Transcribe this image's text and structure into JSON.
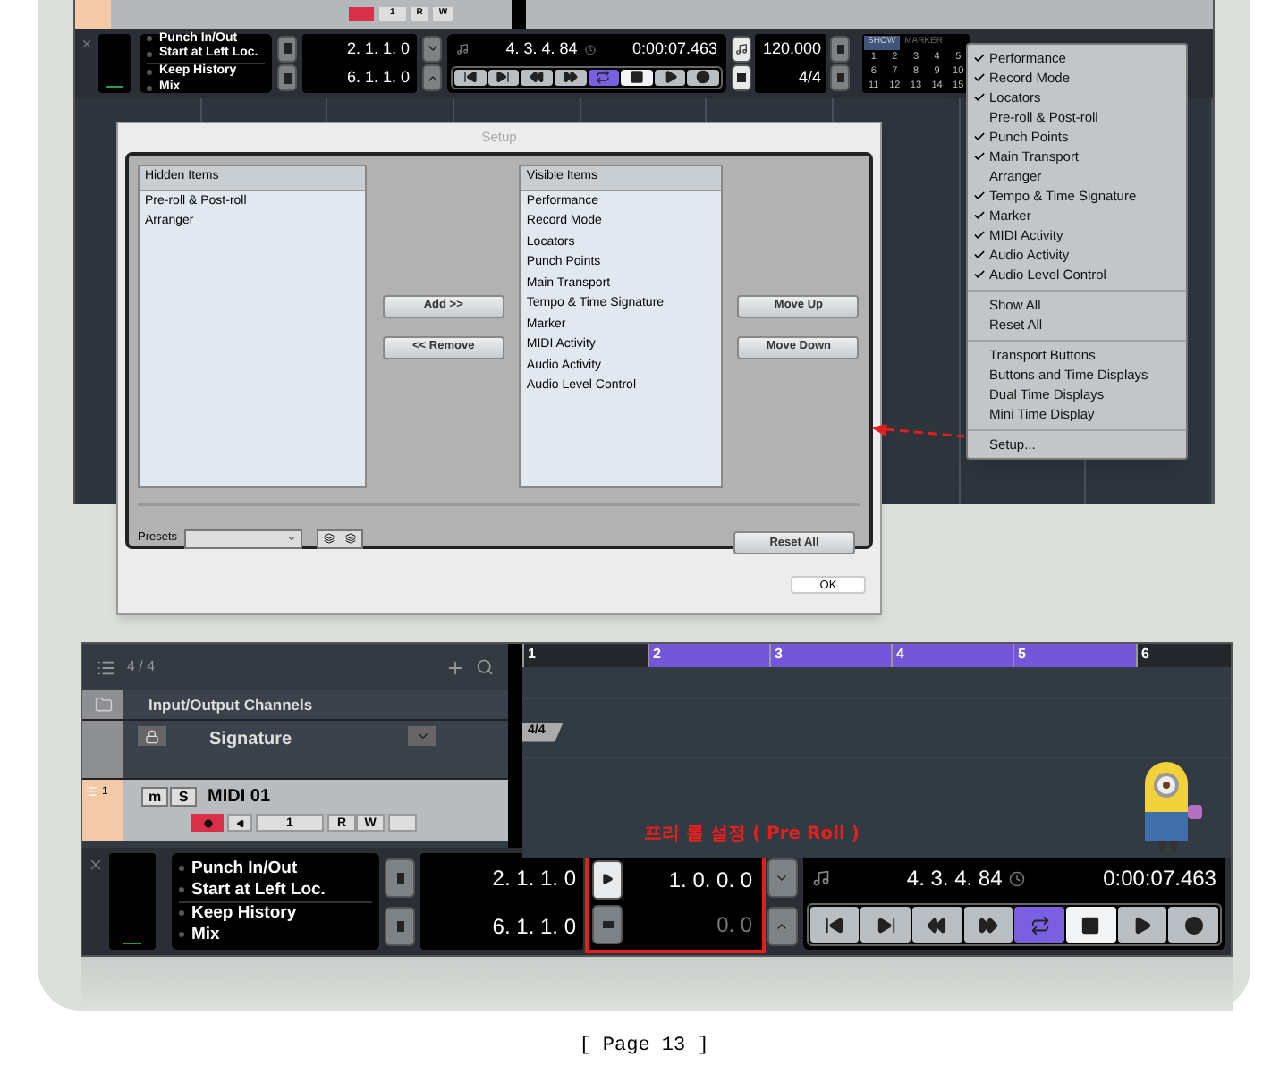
{
  "top_screenshot": {
    "track_strip": {
      "record_enabled": true,
      "channel": "1",
      "read": "R",
      "write": "W"
    },
    "transport": {
      "punch_options": [
        "Punch In/Out",
        "Start at Left Loc.",
        "Keep History",
        "Mix"
      ],
      "left_locator": "2. 1. 1. 0",
      "right_locator": "6. 1. 1. 0",
      "position_bars": "4. 3. 4. 84",
      "position_time": "0:00:07.463",
      "buttons": [
        {
          "kind": "to-start",
          "on": false
        },
        {
          "kind": "to-end",
          "on": false
        },
        {
          "kind": "rewind",
          "on": false
        },
        {
          "kind": "forward",
          "on": false
        },
        {
          "kind": "cycle",
          "on": true
        },
        {
          "kind": "stop",
          "on": true
        },
        {
          "kind": "play",
          "on": false
        },
        {
          "kind": "record",
          "on": false
        }
      ],
      "tempo": "120.000",
      "signature": "4/4",
      "marker_panel": {
        "tabs": [
          {
            "label": "SHOW",
            "selected": true
          },
          {
            "label": "MARKER",
            "selected": false
          }
        ],
        "numbers": [
          "1",
          "2",
          "3",
          "4",
          "5",
          "6",
          "7",
          "8",
          "9",
          "10",
          "11",
          "12",
          "13",
          "14",
          "15"
        ]
      }
    },
    "setup_dialog": {
      "title": "Setup",
      "hidden_items": {
        "header": "Hidden Items",
        "items": [
          "Pre-roll & Post-roll",
          "Arranger"
        ]
      },
      "visible_items": {
        "header": "Visible Items",
        "items": [
          "Performance",
          "Record Mode",
          "Locators",
          "Punch Points",
          "Main Transport",
          "Tempo & Time Signature",
          "Marker",
          "MIDI Activity",
          "Audio Activity",
          "Audio Level Control"
        ]
      },
      "transfer_buttons": [
        "Add >>",
        "<< Remove"
      ],
      "order_buttons": [
        "Move Up",
        "Move Down"
      ],
      "presets_label": "Presets",
      "presets_value": "-",
      "reset_button": "Reset All",
      "ok_button": "OK"
    },
    "context_menu": {
      "groups": [
        [
          {
            "label": "Performance",
            "checked": true
          },
          {
            "label": "Record Mode",
            "checked": true
          },
          {
            "label": "Locators",
            "checked": true
          },
          {
            "label": "Pre-roll & Post-roll",
            "checked": false
          },
          {
            "label": "Punch Points",
            "checked": true
          },
          {
            "label": "Main Transport",
            "checked": true
          },
          {
            "label": "Arranger",
            "checked": false
          },
          {
            "label": "Tempo & Time Signature",
            "checked": true
          },
          {
            "label": "Marker",
            "checked": true
          },
          {
            "label": "MIDI Activity",
            "checked": true
          },
          {
            "label": "Audio Activity",
            "checked": true
          },
          {
            "label": "Audio Level Control",
            "checked": true
          }
        ],
        [
          {
            "label": "Show All",
            "checked": false
          },
          {
            "label": "Reset All",
            "checked": false
          }
        ],
        [
          {
            "label": "Transport Buttons",
            "checked": false
          },
          {
            "label": "Buttons and Time Displays",
            "checked": false
          },
          {
            "label": "Dual Time Displays",
            "checked": false
          },
          {
            "label": "Mini Time Display",
            "checked": false
          }
        ],
        [
          {
            "label": "Setup...",
            "checked": false
          }
        ]
      ]
    }
  },
  "bottom_screenshot": {
    "track_count": "4 / 4",
    "ruler": [
      {
        "label": "1",
        "in_cycle": false
      },
      {
        "label": "2",
        "in_cycle": true
      },
      {
        "label": "3",
        "in_cycle": true
      },
      {
        "label": "4",
        "in_cycle": true
      },
      {
        "label": "5",
        "in_cycle": true
      },
      {
        "label": "6",
        "in_cycle": false
      }
    ],
    "tracks": [
      {
        "kind": "folder",
        "name": "Input/Output Channels"
      },
      {
        "kind": "signature",
        "name": "Signature"
      },
      {
        "kind": "midi",
        "number": "1",
        "name": "MIDI 01",
        "mute": "m",
        "solo": "S",
        "record_enabled": true,
        "channel": "1",
        "read": "R",
        "write": "W"
      }
    ],
    "signature_marker": "4/4",
    "annotation": "프리 롤 설정 ( Pre Roll )",
    "transport": {
      "punch_options": [
        "Punch In/Out",
        "Start at Left Loc.",
        "Keep History",
        "Mix"
      ],
      "left_locator": "2. 1. 1. 0",
      "right_locator": "6. 1. 1. 0",
      "pre_roll": {
        "pre_value": "1. 0. 0. 0",
        "post_value": "0. 0",
        "pre_on": true,
        "post_on": false,
        "highlighted": true
      },
      "position_bars": "4. 3. 4. 84",
      "position_time": "0:00:07.463",
      "buttons": [
        {
          "kind": "to-start",
          "on": false
        },
        {
          "kind": "to-end",
          "on": false
        },
        {
          "kind": "rewind",
          "on": false
        },
        {
          "kind": "forward",
          "on": false
        },
        {
          "kind": "cycle",
          "on": true
        },
        {
          "kind": "stop",
          "on": true
        },
        {
          "kind": "play",
          "on": false
        },
        {
          "kind": "record",
          "on": false
        }
      ]
    }
  },
  "caption": "[ Page 13 ]"
}
